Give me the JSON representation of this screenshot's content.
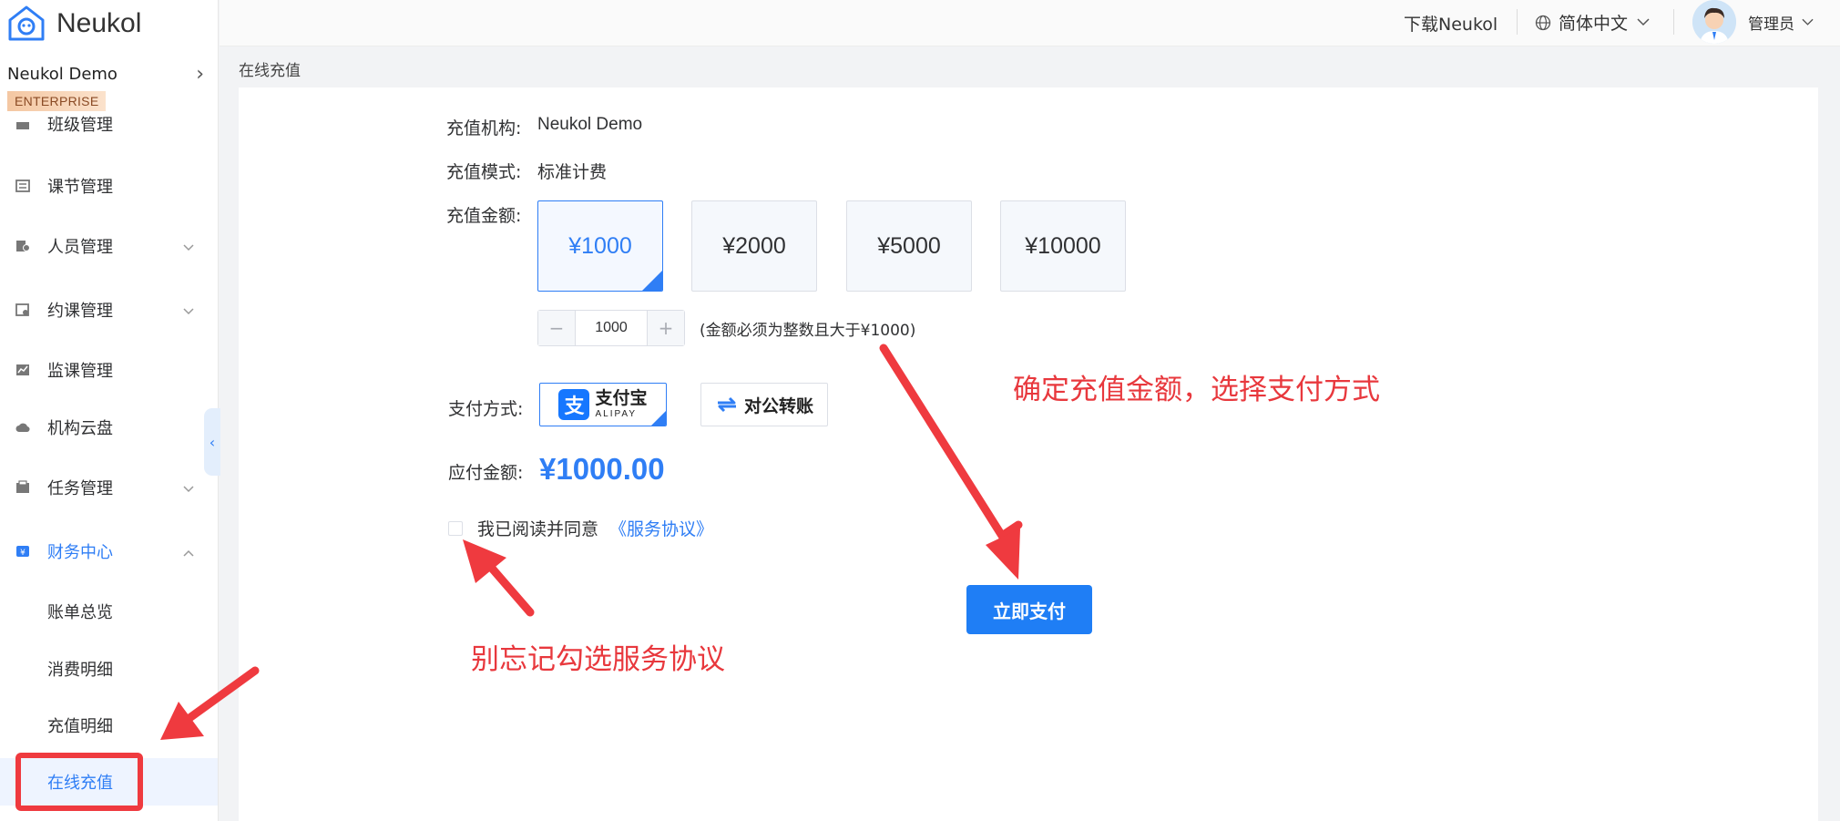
{
  "app": {
    "name": "Neukol",
    "org_name": "Neukol Demo",
    "plan_badge": "ENTERPRISE",
    "accent": "#2f7ef5"
  },
  "header": {
    "download": "下载Neukol",
    "language": "简体中文",
    "user": "管理员",
    "icons": [
      "globe-icon",
      "chevron-down-icon",
      "avatar"
    ]
  },
  "sidebar": {
    "items": [
      {
        "label": "班级管理",
        "icon": "class-icon"
      },
      {
        "label": "课节管理",
        "icon": "list-icon"
      },
      {
        "label": "人员管理",
        "icon": "people-icon",
        "expandable": true
      },
      {
        "label": "约课管理",
        "icon": "calendar-icon",
        "expandable": true
      },
      {
        "label": "监课管理",
        "icon": "monitor-icon"
      },
      {
        "label": "机构云盘",
        "icon": "cloud-icon"
      },
      {
        "label": "任务管理",
        "icon": "task-icon",
        "expandable": true
      },
      {
        "label": "财务中心",
        "icon": "finance-icon",
        "expanded": true
      }
    ],
    "finance_children": [
      {
        "label": "账单总览"
      },
      {
        "label": "消费明细"
      },
      {
        "label": "充值明细"
      },
      {
        "label": "在线充值",
        "active": true
      }
    ]
  },
  "breadcrumb": "在线充值",
  "form": {
    "org_label": "充值机构:",
    "org_value": "Neukol Demo",
    "mode_label": "充值模式:",
    "mode_value": "标准计费",
    "amount_label": "充值金额:",
    "amounts": [
      "¥1000",
      "¥2000",
      "¥5000",
      "¥10000"
    ],
    "selected_amount_index": 0,
    "stepper": {
      "minus": "−",
      "value": "1000",
      "plus": "+"
    },
    "amount_hint": "(金额必须为整数且大于¥1000)",
    "pay_method_label": "支付方式:",
    "pay_methods": {
      "alipay": {
        "cn": "支付宝",
        "en": "ALIPAY",
        "mark": "支"
      },
      "transfer": "对公转账"
    },
    "due_label": "应付金额:",
    "due_value": "¥1000.00",
    "agree_text": "我已阅读并同意",
    "agree_link": "《服务协议》",
    "agree_checked": false,
    "pay_button": "立即支付"
  },
  "annotations": {
    "note_amount": "确定充值金额，选择支付方式",
    "note_agreement": "别忘记勾选服务协议",
    "color": "#e8383d"
  }
}
